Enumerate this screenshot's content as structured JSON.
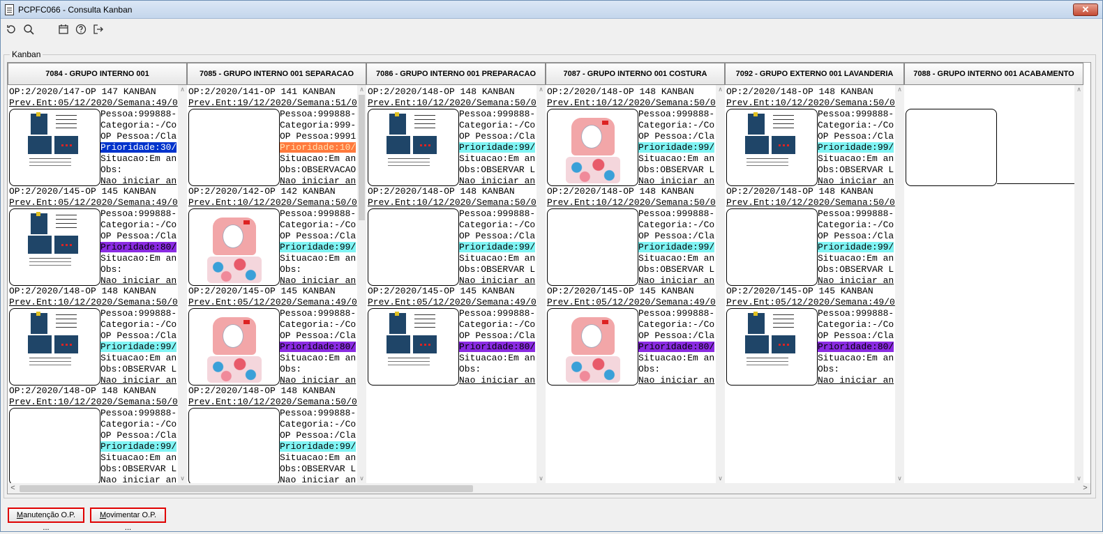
{
  "window": {
    "title": "PCPFC066 - Consulta Kanban",
    "close_label": "✕"
  },
  "toolbar": {
    "icons": [
      "refresh-icon",
      "search-icon",
      "calendar-icon",
      "help-icon",
      "exit-icon"
    ]
  },
  "group_label": "Kanban",
  "columns": [
    {
      "title": "7084 - GRUPO INTERNO 001",
      "cards": [
        {
          "op": "OP:2/2020/147-OP 147 KANBAN",
          "prev": "Prev.Ent:05/12/2020/Semana:49/0",
          "img": "doc",
          "pessoa": "Pessoa:999888-",
          "categoria": "Categoria:-/Co",
          "op_pessoa": "OP Pessoa:/Cla",
          "prioridade": "Prioridade:30/",
          "pri_color": "blue",
          "situacao": "Situacao:Em an",
          "obs": "Obs:",
          "nao": "Nao iniciar an"
        },
        {
          "op": "OP:2/2020/145-OP 145 KANBAN",
          "prev": "Prev.Ent:05/12/2020/Semana:49/0",
          "img": "doc",
          "pessoa": "Pessoa:999888-",
          "categoria": "Categoria:-/Co",
          "op_pessoa": "OP Pessoa:/Cla",
          "prioridade": "Prioridade:80/",
          "pri_color": "purple",
          "situacao": "Situacao:Em an",
          "obs": "Obs:",
          "nao": "Nao iniciar an"
        },
        {
          "op": "OP:2/2020/148-OP 148 KANBAN",
          "prev": "Prev.Ent:10/12/2020/Semana:50/0",
          "img": "doc",
          "pessoa": "Pessoa:999888-",
          "categoria": "Categoria:-/Co",
          "op_pessoa": "OP Pessoa:/Cla",
          "prioridade": "Prioridade:99/",
          "pri_color": "cyan",
          "situacao": "Situacao:Em an",
          "obs": "Obs:OBSERVAR L",
          "nao": "Nao iniciar an"
        },
        {
          "op": "OP:2/2020/148-OP 148 KANBAN",
          "prev": "Prev.Ent:10/12/2020/Semana:50/0",
          "img": "blank",
          "pessoa": "Pessoa:999888-",
          "categoria": "Categoria:-/Co",
          "op_pessoa": "OP Pessoa:/Cla",
          "prioridade": "Prioridade:99/",
          "pri_color": "cyan",
          "situacao": "Situacao:Em an",
          "obs": "Obs:OBSERVAR L",
          "nao": "Nao iniciar an"
        }
      ]
    },
    {
      "title": "7085 - GRUPO INTERNO 001 SEPARACAO",
      "cards": [
        {
          "op": "OP:2/2020/141-OP 141 KANBAN",
          "prev": "Prev.Ent:19/12/2020/Semana:51/0",
          "img": "blank",
          "pessoa": "Pessoa:999888-",
          "categoria": "Categoria:999-",
          "op_pessoa": "OP Pessoa:9991",
          "prioridade": "Prioridade:10/",
          "pri_color": "orange",
          "situacao": "Situacao:Em an",
          "obs": "Obs:OBSERVACAO",
          "nao": "Nao iniciar an"
        },
        {
          "op": "OP:2/2020/142-OP 142 KANBAN",
          "prev": "Prev.Ent:10/12/2020/Semana:50/0",
          "img": "garment",
          "pessoa": "Pessoa:999888-",
          "categoria": "Categoria:-/Co",
          "op_pessoa": "OP Pessoa:/Cla",
          "prioridade": "Prioridade:99/",
          "pri_color": "cyan",
          "situacao": "Situacao:Em an",
          "obs": "Obs:",
          "nao": "Nao iniciar an"
        },
        {
          "op": "OP:2/2020/145-OP 145 KANBAN",
          "prev": "Prev.Ent:05/12/2020/Semana:49/0",
          "img": "garment",
          "pessoa": "Pessoa:999888-",
          "categoria": "Categoria:-/Co",
          "op_pessoa": "OP Pessoa:/Cla",
          "prioridade": "Prioridade:80/",
          "pri_color": "purple",
          "situacao": "Situacao:Em an",
          "obs": "Obs:",
          "nao": "Nao iniciar an"
        },
        {
          "op": "OP:2/2020/148-OP 148 KANBAN",
          "prev": "Prev.Ent:10/12/2020/Semana:50/0",
          "img": "blank",
          "pessoa": "Pessoa:999888-",
          "categoria": "Categoria:-/Co",
          "op_pessoa": "OP Pessoa:/Cla",
          "prioridade": "Prioridade:99/",
          "pri_color": "cyan",
          "situacao": "Situacao:Em an",
          "obs": "Obs:OBSERVAR L",
          "nao": "Nao iniciar an"
        }
      ]
    },
    {
      "title": "7086 - GRUPO INTERNO 001 PREPARACAO",
      "cards": [
        {
          "op": "OP:2/2020/148-OP 148 KANBAN",
          "prev": "Prev.Ent:10/12/2020/Semana:50/0",
          "img": "doc",
          "pessoa": "Pessoa:999888-",
          "categoria": "Categoria:-/Co",
          "op_pessoa": "OP Pessoa:/Cla",
          "prioridade": "Prioridade:99/",
          "pri_color": "cyan",
          "situacao": "Situacao:Em an",
          "obs": "Obs:OBSERVAR L",
          "nao": "Nao iniciar an"
        },
        {
          "op": "OP:2/2020/148-OP 148 KANBAN",
          "prev": "Prev.Ent:10/12/2020/Semana:50/0",
          "img": "blank",
          "pessoa": "Pessoa:999888-",
          "categoria": "Categoria:-/Co",
          "op_pessoa": "OP Pessoa:/Cla",
          "prioridade": "Prioridade:99/",
          "pri_color": "cyan",
          "situacao": "Situacao:Em an",
          "obs": "Obs:OBSERVAR L",
          "nao": "Nao iniciar an"
        },
        {
          "op": "OP:2/2020/145-OP 145 KANBAN",
          "prev": "Prev.Ent:05/12/2020/Semana:49/0",
          "img": "doc",
          "pessoa": "Pessoa:999888-",
          "categoria": "Categoria:-/Co",
          "op_pessoa": "OP Pessoa:/Cla",
          "prioridade": "Prioridade:80/",
          "pri_color": "purple",
          "situacao": "Situacao:Em an",
          "obs": "Obs:",
          "nao": "Nao iniciar an"
        }
      ]
    },
    {
      "title": "7087 - GRUPO INTERNO 001 COSTURA",
      "cards": [
        {
          "op": "OP:2/2020/148-OP 148 KANBAN",
          "prev": "Prev.Ent:10/12/2020/Semana:50/0",
          "img": "garment",
          "pessoa": "Pessoa:999888-",
          "categoria": "Categoria:-/Co",
          "op_pessoa": "OP Pessoa:/Cla",
          "prioridade": "Prioridade:99/",
          "pri_color": "cyan",
          "situacao": "Situacao:Em an",
          "obs": "Obs:OBSERVAR L",
          "nao": "Nao iniciar an"
        },
        {
          "op": "OP:2/2020/148-OP 148 KANBAN",
          "prev": "Prev.Ent:10/12/2020/Semana:50/0",
          "img": "blank",
          "pessoa": "Pessoa:999888-",
          "categoria": "Categoria:-/Co",
          "op_pessoa": "OP Pessoa:/Cla",
          "prioridade": "Prioridade:99/",
          "pri_color": "cyan",
          "situacao": "Situacao:Em an",
          "obs": "Obs:OBSERVAR L",
          "nao": "Nao iniciar an"
        },
        {
          "op": "OP:2/2020/145-OP 145 KANBAN",
          "prev": "Prev.Ent:05/12/2020/Semana:49/0",
          "img": "garment",
          "pessoa": "Pessoa:999888-",
          "categoria": "Categoria:-/Co",
          "op_pessoa": "OP Pessoa:/Cla",
          "prioridade": "Prioridade:80/",
          "pri_color": "purple",
          "situacao": "Situacao:Em an",
          "obs": "Obs:",
          "nao": "Nao iniciar an"
        }
      ]
    },
    {
      "title": "7092 - GRUPO EXTERNO 001 LAVANDERIA",
      "cards": [
        {
          "op": "OP:2/2020/148-OP 148 KANBAN",
          "prev": "Prev.Ent:10/12/2020/Semana:50/0",
          "img": "doc",
          "pessoa": "Pessoa:999888-",
          "categoria": "Categoria:-/Co",
          "op_pessoa": "OP Pessoa:/Cla",
          "prioridade": "Prioridade:99/",
          "pri_color": "cyan",
          "situacao": "Situacao:Em an",
          "obs": "Obs:OBSERVAR L",
          "nao": "Nao iniciar an"
        },
        {
          "op": "OP:2/2020/148-OP 148 KANBAN",
          "prev": "Prev.Ent:10/12/2020/Semana:50/0",
          "img": "blank",
          "pessoa": "Pessoa:999888-",
          "categoria": "Categoria:-/Co",
          "op_pessoa": "OP Pessoa:/Cla",
          "prioridade": "Prioridade:99/",
          "pri_color": "cyan",
          "situacao": "Situacao:Em an",
          "obs": "Obs:OBSERVAR L",
          "nao": "Nao iniciar an"
        },
        {
          "op": "OP:2/2020/145-OP 145 KANBAN",
          "prev": "Prev.Ent:05/12/2020/Semana:49/0",
          "img": "doc",
          "pessoa": "Pessoa:999888-",
          "categoria": "Categoria:-/Co",
          "op_pessoa": "OP Pessoa:/Cla",
          "prioridade": "Prioridade:80/",
          "pri_color": "purple",
          "situacao": "Situacao:Em an",
          "obs": "Obs:",
          "nao": "Nao iniciar an"
        }
      ]
    },
    {
      "title": "7088 - GRUPO INTERNO 001 ACABAMENTO",
      "cards": [],
      "empty_image": true
    }
  ],
  "scroll_arrows": {
    "up": "∧",
    "down": "∨",
    "left": "<",
    "right": ">"
  },
  "footer": {
    "btn1": {
      "mnemonic": "M",
      "rest": "anutenção O.P. ..."
    },
    "btn2": {
      "mnemonic": "M",
      "rest": "ovimentar O.P. ..."
    }
  },
  "colors": {
    "pri_blue": "#0033cc",
    "pri_orange": "#ff7a3d",
    "pri_purple": "#8a2be2",
    "pri_cyan": "#80f4f4",
    "footer_border": "#e00000"
  }
}
